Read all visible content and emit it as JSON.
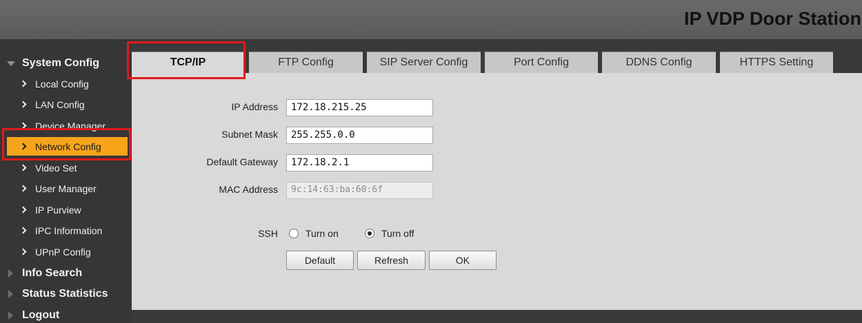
{
  "header": {
    "title": "IP VDP Door Station"
  },
  "sidebar": {
    "system_config": "System Config",
    "items": [
      {
        "label": "Local Config"
      },
      {
        "label": "LAN Config"
      },
      {
        "label": "Device Manager"
      },
      {
        "label": "Network Config",
        "active": true
      },
      {
        "label": "Video Set"
      },
      {
        "label": "User Manager"
      },
      {
        "label": "IP Purview"
      },
      {
        "label": "IPC Information"
      },
      {
        "label": "UPnP Config"
      }
    ],
    "info_search": "Info Search",
    "status_statistics": "Status Statistics",
    "logout": "Logout"
  },
  "tabs": [
    {
      "label": "TCP/IP",
      "active": true
    },
    {
      "label": "FTP Config"
    },
    {
      "label": "SIP Server Config"
    },
    {
      "label": "Port Config"
    },
    {
      "label": "DDNS Config"
    },
    {
      "label": "HTTPS Setting"
    }
  ],
  "form": {
    "ip_address": {
      "label": "IP Address",
      "value": "172.18.215.25"
    },
    "subnet_mask": {
      "label": "Subnet Mask",
      "value": "255.255.0.0"
    },
    "default_gateway": {
      "label": "Default Gateway",
      "value": "172.18.2.1"
    },
    "mac_address": {
      "label": "MAC Address",
      "value": "9c:14:63:ba:60:6f"
    },
    "ssh": {
      "label": "SSH",
      "on_label": "Turn on",
      "off_label": "Turn off",
      "selected": "off"
    }
  },
  "buttons": {
    "default": "Default",
    "refresh": "Refresh",
    "ok": "OK"
  },
  "colors": {
    "active_item": "#f7a41b",
    "highlight": "#e01b1b"
  }
}
